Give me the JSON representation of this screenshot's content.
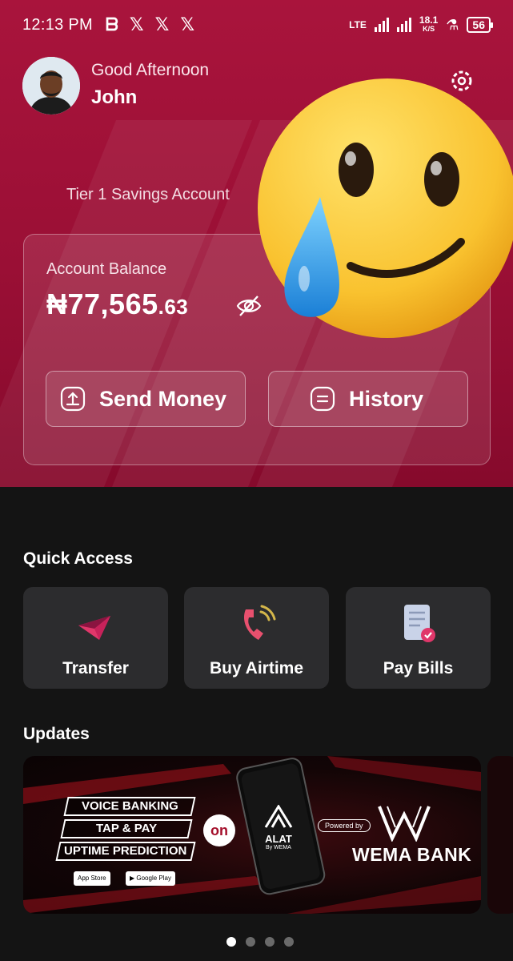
{
  "status_bar": {
    "time": "12:13 PM",
    "notification_icons": [
      "b-app-icon",
      "x-icon",
      "x-icon",
      "x-icon"
    ],
    "network_label": "LTE",
    "speed_value": "18.1",
    "speed_unit": "K/S",
    "battery": "56"
  },
  "header": {
    "greeting": "Good Afternoon",
    "user_name": "John"
  },
  "account": {
    "tier_label": "Tier 1 Savings Account",
    "balance_label": "Account Balance",
    "balance_main": "₦77,565",
    "balance_decimal": ".63"
  },
  "actions": {
    "send_label": "Send Money",
    "history_label": "History"
  },
  "quick_access": {
    "title": "Quick Access",
    "items": [
      {
        "label": "Transfer",
        "icon": "transfer-plane-icon"
      },
      {
        "label": "Buy Airtime",
        "icon": "phone-signal-icon"
      },
      {
        "label": "Pay Bills",
        "icon": "bill-document-icon"
      }
    ]
  },
  "updates": {
    "title": "Updates",
    "banner": {
      "feature_1": "VOICE BANKING",
      "feature_2": "TAP & PAY",
      "feature_3": "UPTIME PREDICTION",
      "app_store": "App Store",
      "google_play": "Google Play",
      "on_text": "on",
      "alat_name": "ALAT",
      "alat_by": "By WEMA",
      "powered_by": "Powered by",
      "bank_name": "WEMA BANK"
    },
    "pagination": {
      "count": 4,
      "active": 1
    }
  },
  "colors": {
    "brand": "#a9143c",
    "background": "#141414",
    "card_tile": "#2c2c2e"
  }
}
